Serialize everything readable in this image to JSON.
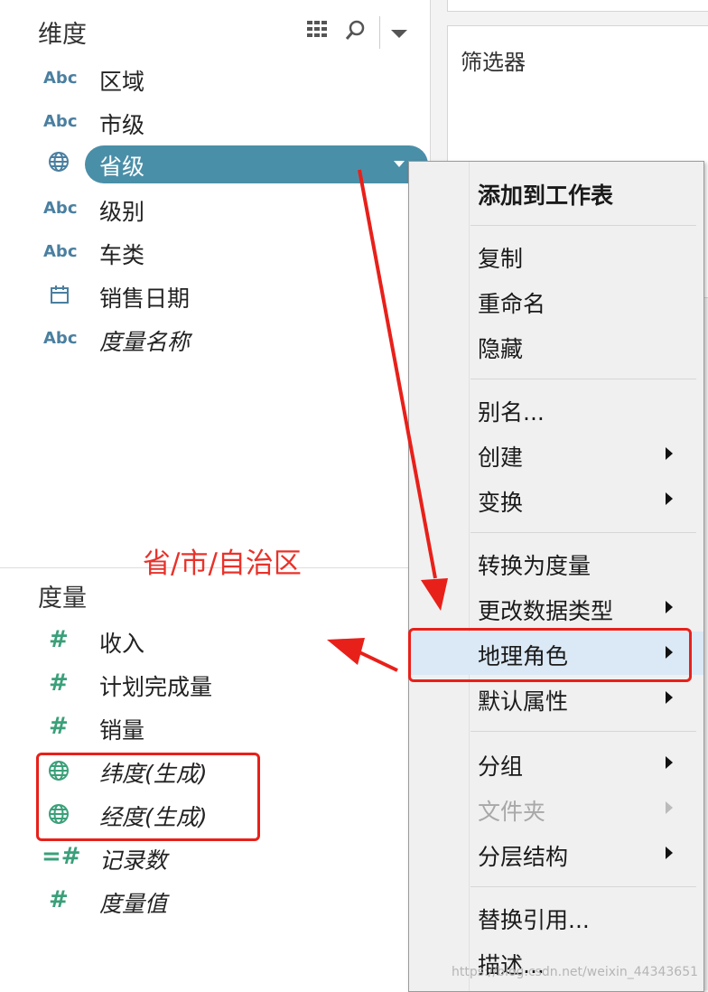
{
  "dimensions": {
    "title": "维度",
    "fields": [
      {
        "type": "Abc",
        "name": "区域"
      },
      {
        "type": "Abc",
        "name": "市级"
      },
      {
        "type": "globe",
        "name": "省级"
      },
      {
        "type": "Abc",
        "name": "级别"
      },
      {
        "type": "Abc",
        "name": "车类"
      },
      {
        "type": "calendar",
        "name": "销售日期"
      },
      {
        "type": "Abc",
        "name": "度量名称"
      }
    ]
  },
  "measures": {
    "title": "度量",
    "fields": [
      {
        "type": "#",
        "name": "收入"
      },
      {
        "type": "#",
        "name": "计划完成量"
      },
      {
        "type": "#",
        "name": "销量"
      },
      {
        "type": "globe",
        "name": "纬度(生成)"
      },
      {
        "type": "globe",
        "name": "经度(生成)"
      },
      {
        "type": "=#",
        "name": "记录数"
      },
      {
        "type": "#",
        "name": "度量值"
      }
    ]
  },
  "filters": {
    "label": "筛选器"
  },
  "annotation": "省/市/自治区",
  "context_menu": {
    "items": [
      {
        "label": "添加到工作表"
      },
      {
        "label": "复制"
      },
      {
        "label": "重命名"
      },
      {
        "label": "隐藏"
      },
      {
        "label": "别名..."
      },
      {
        "label": "创建"
      },
      {
        "label": "变换"
      },
      {
        "label": "转换为度量"
      },
      {
        "label": "更改数据类型"
      },
      {
        "label": "地理角色"
      },
      {
        "label": "默认属性"
      },
      {
        "label": "分组"
      },
      {
        "label": "文件夹"
      },
      {
        "label": "分层结构"
      },
      {
        "label": "替换引用..."
      },
      {
        "label": "描述..."
      }
    ]
  },
  "icons": {
    "grid": "grid-view-icon",
    "search": "search-icon",
    "dropdown": "dropdown-arrow-icon",
    "globe": "globe-icon",
    "calendar": "calendar-icon",
    "submenu": "submenu-arrow-icon"
  },
  "colors": {
    "pill": "#4a8fa8",
    "dimension_icon": "#4a7fa0",
    "measure_icon": "#3aa07a",
    "annotation": "#e8322a",
    "highlight": "#dbe8f5"
  },
  "watermark": "https://blog.csdn.net/weixin_44343651"
}
